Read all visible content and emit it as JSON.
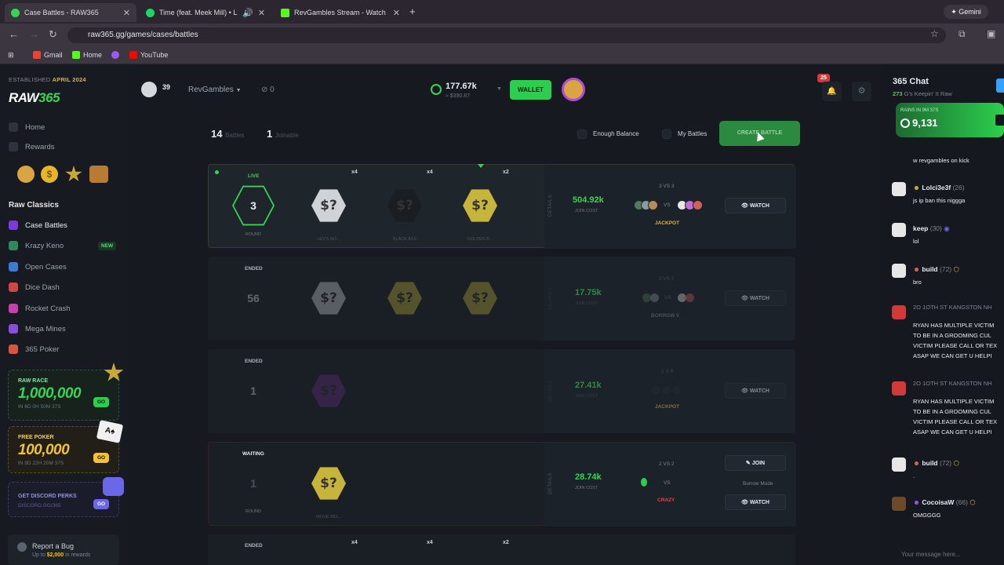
{
  "browser": {
    "tabs": [
      {
        "title": "Case Battles - RAW365",
        "active": true
      },
      {
        "title": "Time (feat. Meek Mill) • Lil E",
        "active": false
      },
      {
        "title": "RevGambles Stream - Watch Li",
        "active": false
      }
    ],
    "new_tab": "+",
    "gemini": "Gemini",
    "url": "raw365.gg/games/cases/battles",
    "bookmarks": [
      "Gmail",
      "Home",
      "YouTube"
    ]
  },
  "sidebar": {
    "established": "ESTABLISHED",
    "established_date": "APRIL 2024",
    "logo_a": "RAW",
    "logo_b": "365",
    "nav": [
      {
        "label": "Home"
      },
      {
        "label": "Rewards"
      }
    ],
    "category": "Raw Classics",
    "games": [
      {
        "label": "Case Battles",
        "color": "#39d353"
      },
      {
        "label": "Krazy Keno",
        "color": "#3aa0ff"
      },
      {
        "label": "Open Cases",
        "color": "#e7a23a"
      },
      {
        "label": "Dice Dash",
        "color": "#e64d4d"
      },
      {
        "label": "Rocket Crash",
        "color": "#d94dd9"
      },
      {
        "label": "Mega Mines",
        "color": "#9a5cf0"
      },
      {
        "label": "365 Poker",
        "color": "#e06a4d"
      }
    ],
    "new_badge": "NEW",
    "race": {
      "label": "RAW RACE",
      "amount": "1,000,000",
      "timer": "IN 6D 0H 50M 37S",
      "go": "GO"
    },
    "poker": {
      "label": "FREE POKER",
      "amount": "100,000",
      "timer": "IN 9D 22H 20M 37S",
      "go": "GO"
    },
    "discord": {
      "label": "GET DISCORD PERKS",
      "link": "DISCORD.GG/365",
      "go": "GO"
    },
    "bug": {
      "title": "Report a Bug",
      "sub_prefix": "Up to",
      "sub_amount": "$2,000",
      "sub_suffix": "in rewards"
    }
  },
  "topbar": {
    "level": "39",
    "username": "RevGambles",
    "coins": "0",
    "balance": "177.67k",
    "balance_usd": "≈ $390.87",
    "wallet": "WALLET",
    "notif_count": "25"
  },
  "filters": {
    "battles_count": "14",
    "battles_label": "Battles",
    "joinable_count": "1",
    "joinable_label": "Joinable",
    "enough_balance": "Enough Balance",
    "my_battles": "My Battles",
    "create": "CREATE BATTLE"
  },
  "battles": [
    {
      "status": "LIVE",
      "round": "3",
      "round_label": "ROUND",
      "cases": [
        {
          "mult": "x4",
          "name": "LEV'S NO..."
        },
        {
          "mult": "x4",
          "name": "BLACK ASS"
        },
        {
          "mult": "x2",
          "name": "GOLDEN B..."
        }
      ],
      "cost": "504.92k",
      "cost_label": "JOIN COST",
      "team": "3 VS 3",
      "vs": "VS",
      "mode": "JACKPOT",
      "details": "DETAILS",
      "watch": "WATCH"
    },
    {
      "status": "ENDED",
      "round": "56",
      "cost": "17.75k",
      "cost_label": "JOIN COST",
      "team": "2 VS 2",
      "vs": "VS",
      "mode": "BORROW 5",
      "details": "DETAILS",
      "watch": "WATCH"
    },
    {
      "status": "ENDED",
      "round": "1",
      "cost": "27.41k",
      "cost_label": "JOIN COST",
      "team": "1 V 4",
      "mode": "JACKPOT",
      "details": "DETAILS",
      "watch": "WATCH"
    },
    {
      "status": "WAITING",
      "round": "1",
      "round_label": "ROUND",
      "case_name": "MOVE WO...",
      "cost": "28.74k",
      "cost_label": "JOIN COST",
      "team": "2 VS 2",
      "vs": "VS",
      "mode": "CRAZY",
      "details": "DETAILS",
      "join": "JOIN",
      "borrow": "Borrow Mode",
      "watch": "WATCH"
    },
    {
      "status": "ENDED",
      "mults": [
        "x4",
        "x4",
        "x2"
      ]
    }
  ],
  "chat": {
    "title": "365 Chat",
    "online_count": "273",
    "online_label": "G's Keepin' It Raw",
    "rain_label": "RAINS IN 9M 37S",
    "rain_amount": "9,131",
    "messages": [
      {
        "name": "",
        "text": "w revgambles on kick"
      },
      {
        "name": "Lolci3e3f",
        "level": "(26)",
        "text": "js ip ban this niggga"
      },
      {
        "name": "keep",
        "level": "(30)",
        "text": "lol"
      },
      {
        "name": "build",
        "level": "(72)",
        "text": "bro"
      },
      {
        "name": "2O 1OTH ST KANGSTON NH",
        "lines": [
          "RYAN HAS MULTIPLE VICTIM",
          "TO BE IN A GROOMING CUL",
          "VICTIM PLEASE CALL OR TEX",
          "ASAP WE CAN GET U HELPI"
        ]
      },
      {
        "name": "2O 1OTH ST KANGSTON NH",
        "lines": [
          "RYAN HAS MULTIPLE VICTIM",
          "TO BE IN A GROOMING CUL",
          "VICTIM PLEASE CALL OR TEX",
          "ASAP WE CAN GET U HELPI"
        ]
      },
      {
        "name": "build",
        "level": "(72)",
        "text": "."
      },
      {
        "name": "CocoisaW",
        "level": "(66)",
        "text": "OMGGGG"
      }
    ],
    "placeholder": "Your message here..."
  },
  "colors": {
    "accent": "#39d353",
    "gold": "#d8b23d",
    "bg": "#14181e"
  }
}
